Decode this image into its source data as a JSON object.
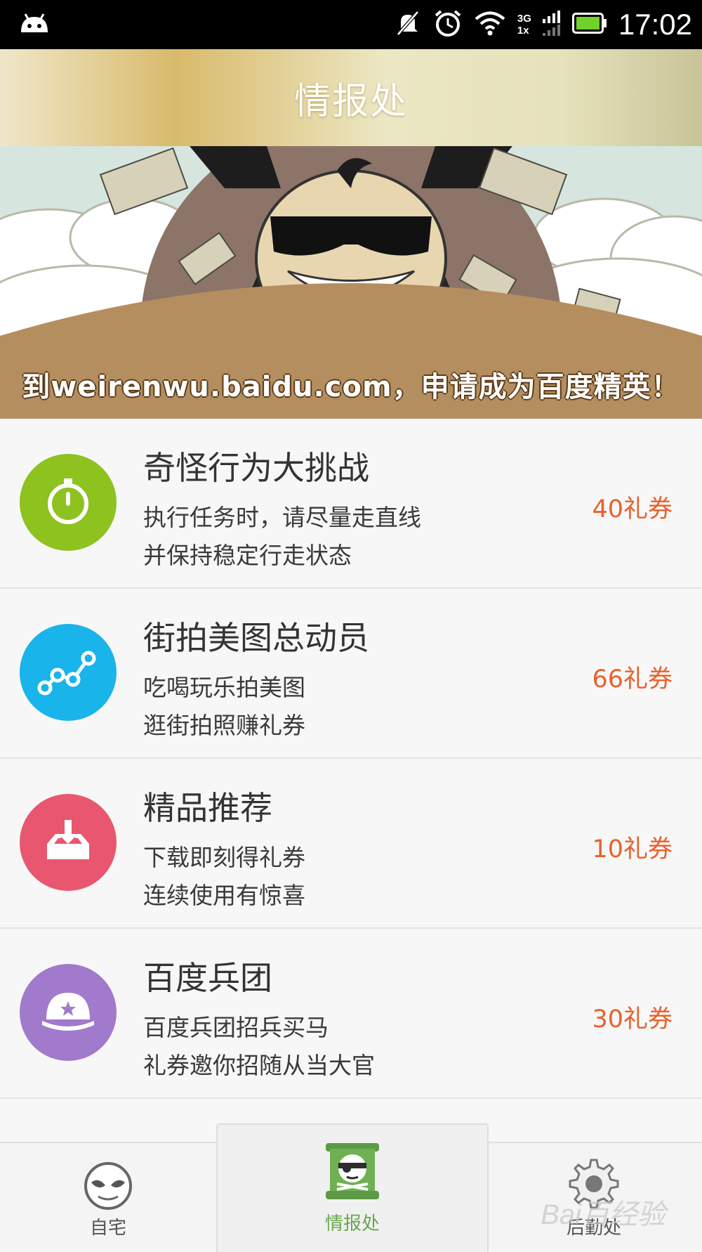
{
  "status_bar": {
    "time": "17:02",
    "network_top": "3G",
    "network_bottom": "1x",
    "icons": [
      "android-icon",
      "mute-icon",
      "alarm-icon",
      "wifi-icon",
      "signal-icon",
      "battery-icon"
    ]
  },
  "header": {
    "title": "情报处"
  },
  "banner": {
    "text": "到weirenwu.baidu.com，申请成为百度精英！"
  },
  "tasks": [
    {
      "title": "奇怪行为大挑战",
      "desc1": "执行任务时，请尽量走直线",
      "desc2": "并保持稳定行走状态",
      "reward": "40礼券",
      "icon": "stopwatch-icon",
      "color": "#8dc21f"
    },
    {
      "title": "街拍美图总动员",
      "desc1": "吃喝玩乐拍美图",
      "desc2": "逛街拍照赚礼券",
      "reward": "66礼券",
      "icon": "route-icon",
      "color": "#19b4ea"
    },
    {
      "title": "精品推荐",
      "desc1": "下载即刻得礼券",
      "desc2": "连续使用有惊喜",
      "reward": "10礼券",
      "icon": "download-tray-icon",
      "color": "#e8576f"
    },
    {
      "title": "百度兵团",
      "desc1": "百度兵团招兵买马",
      "desc2": "礼券邀你招随从当大官",
      "reward": "30礼券",
      "icon": "helmet-icon",
      "color": "#a27acb"
    }
  ],
  "bottom_nav": {
    "home": {
      "label": "自宅",
      "icon": "mask-face-icon"
    },
    "intel": {
      "label": "情报处",
      "icon": "pirate-scroll-icon",
      "active": true,
      "active_color": "#6aa84f"
    },
    "logistics": {
      "label": "后勤处",
      "icon": "gear-icon"
    }
  },
  "watermark": "Bai百经验"
}
